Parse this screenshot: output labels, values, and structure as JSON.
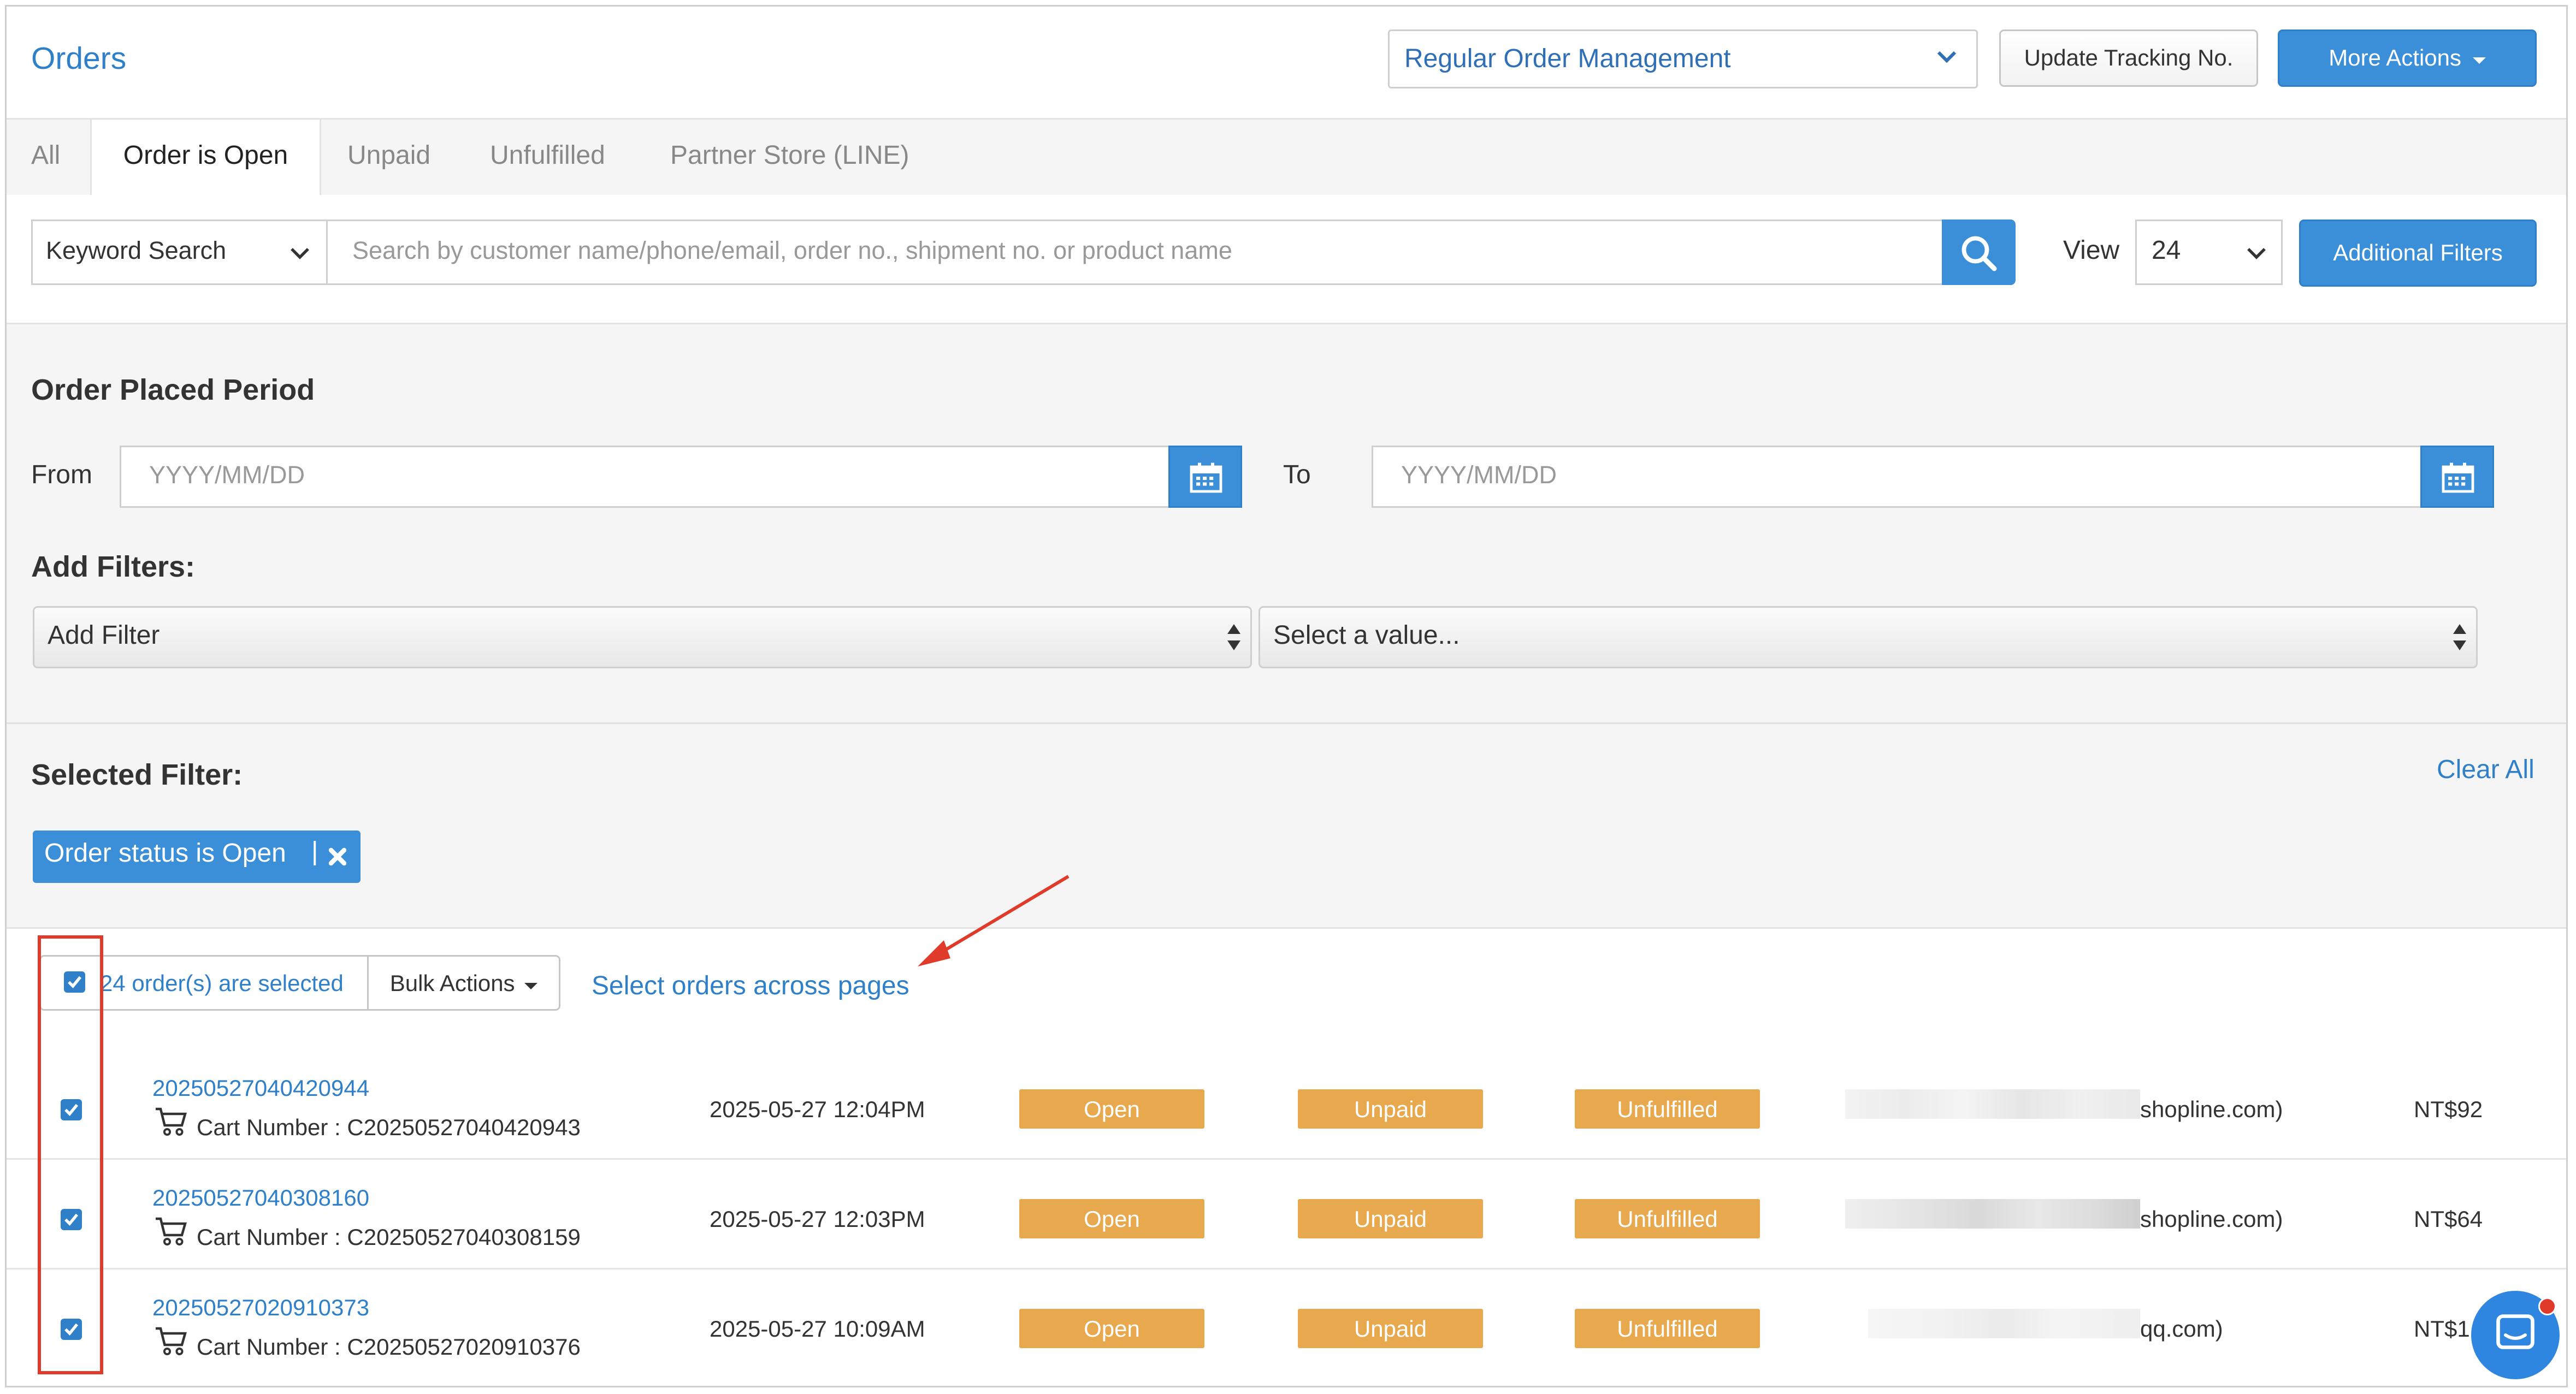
{
  "header": {
    "title": "Orders",
    "management_select": "Regular Order Management",
    "update_tracking_label": "Update Tracking No.",
    "more_actions_label": "More Actions"
  },
  "tabs": [
    {
      "label": "All",
      "active": false
    },
    {
      "label": "Order is Open",
      "active": true
    },
    {
      "label": "Unpaid",
      "active": false
    },
    {
      "label": "Unfulfilled",
      "active": false
    },
    {
      "label": "Partner Store (LINE)",
      "active": false
    }
  ],
  "search": {
    "type_select": "Keyword Search",
    "placeholder": "Search by customer name/phone/email, order no., shipment no. or product name",
    "view_label": "View",
    "view_value": "24",
    "additional_filters_label": "Additional Filters"
  },
  "period": {
    "title": "Order Placed Period",
    "from_label": "From",
    "to_label": "To",
    "date_placeholder": "YYYY/MM/DD"
  },
  "add_filters": {
    "title": "Add Filters:",
    "filter_select": "Add Filter",
    "value_select": "Select a value..."
  },
  "selected_filter": {
    "title": "Selected Filter:",
    "clear_all": "Clear All",
    "chip_label": "Order status is Open"
  },
  "selection": {
    "selected_text": "24 order(s) are selected",
    "bulk_actions_label": "Bulk Actions",
    "select_across_pages": "Select orders across pages"
  },
  "orders": [
    {
      "order_no": "20250527040420944",
      "cart": "Cart Number : C20250527040420943",
      "date": "2025-05-27 12:04PM",
      "status": "Open",
      "payment": "Unpaid",
      "fulfillment": "Unfulfilled",
      "email_suffix": "shopline.com)",
      "amount": "NT$92"
    },
    {
      "order_no": "20250527040308160",
      "cart": "Cart Number : C20250527040308159",
      "date": "2025-05-27 12:03PM",
      "status": "Open",
      "payment": "Unpaid",
      "fulfillment": "Unfulfilled",
      "email_suffix": "shopline.com)",
      "amount": "NT$64"
    },
    {
      "order_no": "20250527020910373",
      "cart": "Cart Number : C20250527020910376",
      "date": "2025-05-27 10:09AM",
      "status": "Open",
      "payment": "Unpaid",
      "fulfillment": "Unfulfilled",
      "email_suffix": "qq.com)",
      "amount": "NT$1"
    }
  ],
  "colors": {
    "primary": "#3b8fd9",
    "link": "#2f80c8",
    "badge": "#e8a94e",
    "annotation": "#e03b2a",
    "panel_bg": "#f5f5f5"
  }
}
